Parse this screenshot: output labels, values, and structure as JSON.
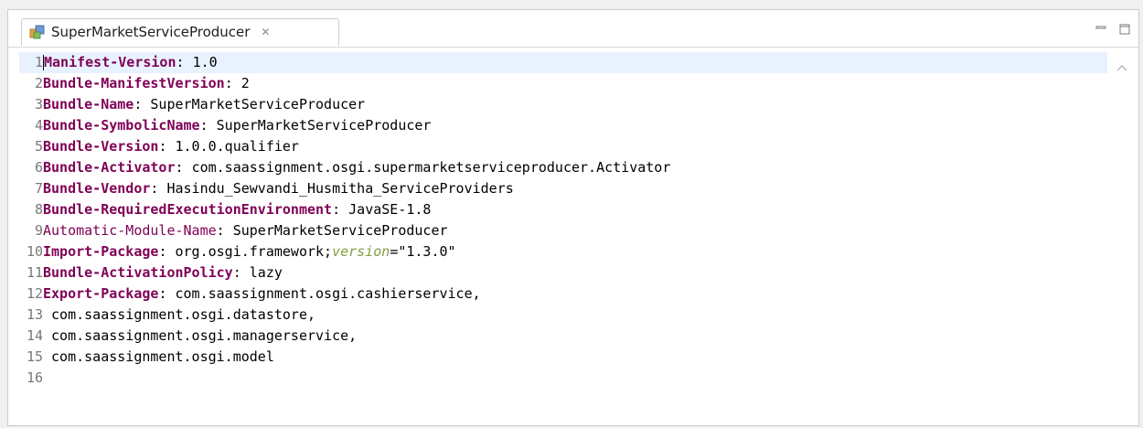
{
  "tab": {
    "title": "SuperMarketServiceProducer",
    "close_glyph": "✕",
    "icon": "manifest-file-icon"
  },
  "view_controls": {
    "minimize_icon": "minimize-icon",
    "maximize_icon": "maximize-icon"
  },
  "colors": {
    "keyword": "#7f0055",
    "attribute": "#7f9f3f",
    "current_line": "#e8f2fe"
  },
  "lines": [
    {
      "num": "1",
      "key": "Manifest-Version",
      "sep": ": ",
      "value": "1.0"
    },
    {
      "num": "2",
      "key": "Bundle-ManifestVersion",
      "sep": ": ",
      "value": "2"
    },
    {
      "num": "3",
      "key": "Bundle-Name",
      "sep": ": ",
      "value": "SuperMarketServiceProducer"
    },
    {
      "num": "4",
      "key": "Bundle-SymbolicName",
      "sep": ": ",
      "value": "SuperMarketServiceProducer"
    },
    {
      "num": "5",
      "key": "Bundle-Version",
      "sep": ": ",
      "value": "1.0.0.qualifier"
    },
    {
      "num": "6",
      "key": "Bundle-Activator",
      "sep": ": ",
      "value": "com.saassignment.osgi.supermarketserviceproducer.Activator"
    },
    {
      "num": "7",
      "key": "Bundle-Vendor",
      "sep": ": ",
      "value": "Hasindu_Sewvandi_Husmitha_ServiceProviders"
    },
    {
      "num": "8",
      "key": "Bundle-RequiredExecutionEnvironment",
      "sep": ": ",
      "value": "JavaSE-1.8"
    },
    {
      "num": "9",
      "key": "Automatic-Module-Name",
      "sep": ": ",
      "value": "SuperMarketServiceProducer"
    },
    {
      "num": "10",
      "key": "Import-Package",
      "sep": ": ",
      "value": "org.osgi.framework;",
      "attr": "version",
      "attr_value": "=\"1.3.0\""
    },
    {
      "num": "11",
      "key": "Bundle-ActivationPolicy",
      "sep": ": ",
      "value": "lazy"
    },
    {
      "num": "12",
      "key": "Export-Package",
      "sep": ": ",
      "value": "com.saassignment.osgi.cashierservice,"
    },
    {
      "num": "13",
      "key": "",
      "sep": "",
      "value": " com.saassignment.osgi.datastore,"
    },
    {
      "num": "14",
      "key": "",
      "sep": "",
      "value": " com.saassignment.osgi.managerservice,"
    },
    {
      "num": "15",
      "key": "",
      "sep": "",
      "value": " com.saassignment.osgi.model"
    },
    {
      "num": "16",
      "key": "",
      "sep": "",
      "value": ""
    }
  ]
}
